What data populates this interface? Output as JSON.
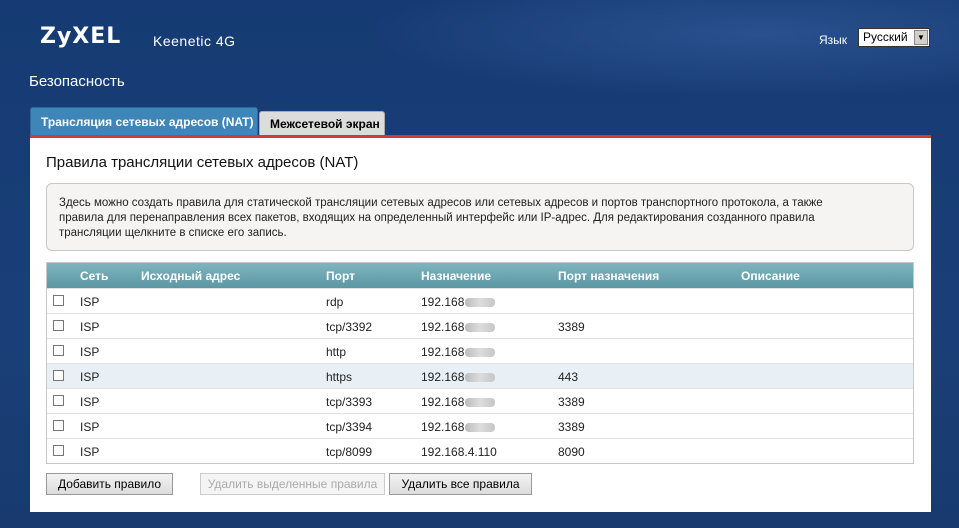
{
  "header": {
    "logo": "ZyXEL",
    "model": "Keenetic 4G",
    "language_label": "Язык",
    "language_value": "Русский"
  },
  "section_title": "Безопасность",
  "tabs": [
    {
      "label": "Трансляция сетевых адресов (NAT)",
      "active": true
    },
    {
      "label": "Межсетевой экран",
      "active": false
    }
  ],
  "panel": {
    "title": "Правила трансляции сетевых адресов (NAT)",
    "info_lines": [
      "Здесь можно создать правила для статической трансляции сетевых адресов или сетевых адресов и портов транспортного протокола, а также",
      "правила для перенаправления всех пакетов, входящих на определенный интерфейс или IP-адрес. Для редактирования созданного правила",
      "трансляции щелкните в списке его запись."
    ]
  },
  "table": {
    "columns": [
      "Сеть",
      "Исходный адрес",
      "Порт",
      "Назначение",
      "Порт назначения",
      "Описание"
    ],
    "rows": [
      {
        "network": "ISP",
        "source": "",
        "port": "rdp",
        "destination": "192.168",
        "dest_port": "",
        "description": "",
        "masked": true
      },
      {
        "network": "ISP",
        "source": "",
        "port": "tcp/3392",
        "destination": "192.168",
        "dest_port": "3389",
        "description": "",
        "masked": true
      },
      {
        "network": "ISP",
        "source": "",
        "port": "http",
        "destination": "192.168",
        "dest_port": "",
        "description": "",
        "masked": true
      },
      {
        "network": "ISP",
        "source": "",
        "port": "https",
        "destination": "192.168",
        "dest_port": "443",
        "description": "",
        "masked": true
      },
      {
        "network": "ISP",
        "source": "",
        "port": "tcp/3393",
        "destination": "192.168",
        "dest_port": "3389",
        "description": "",
        "masked": true
      },
      {
        "network": "ISP",
        "source": "",
        "port": "tcp/3394",
        "destination": "192.168",
        "dest_port": "3389",
        "description": "",
        "masked": true
      },
      {
        "network": "ISP",
        "source": "",
        "port": "tcp/8099",
        "destination": "192.168.4.110",
        "dest_port": "8090",
        "description": "",
        "masked": false
      }
    ]
  },
  "buttons": {
    "add": "Добавить правило",
    "delete_selected": "Удалить выделенные правила",
    "delete_all": "Удалить все правила"
  }
}
